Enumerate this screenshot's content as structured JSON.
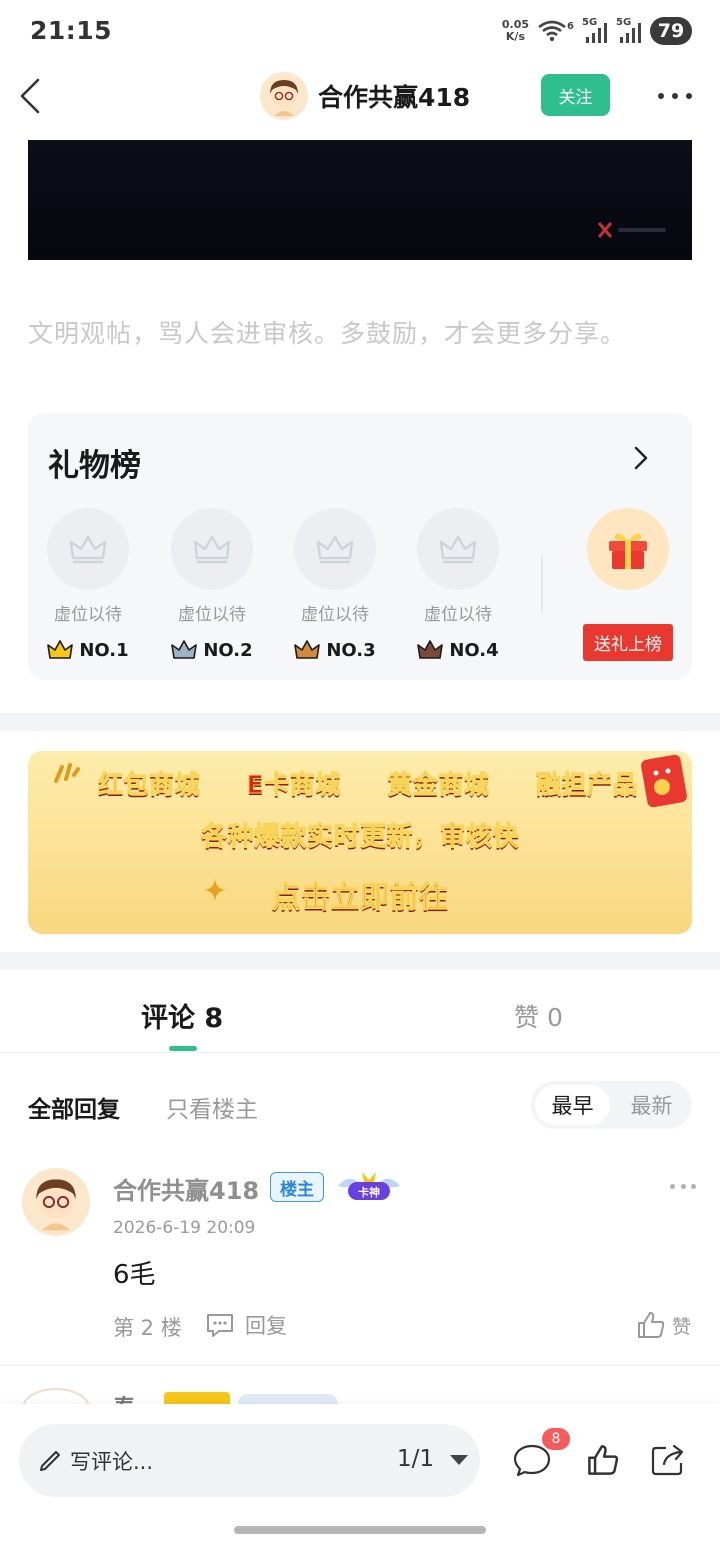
{
  "status_bar": {
    "time": "21:15",
    "net_speed_value": "0.05",
    "net_speed_unit": "K/s",
    "wifi_sub": "6",
    "sig1": "5G",
    "sig2": "5G",
    "battery": "79"
  },
  "header": {
    "title": "合作共赢418",
    "follow_label": "关注"
  },
  "notice": "文明观帖，骂人会进审核。多鼓励，才会更多分享。",
  "gift_board": {
    "title": "礼物榜",
    "slots": [
      {
        "label": "虚位以待",
        "rank": "NO.1",
        "crown_color": "#f5c518"
      },
      {
        "label": "虚位以待",
        "rank": "NO.2",
        "crown_color": "#9fb3c8"
      },
      {
        "label": "虚位以待",
        "rank": "NO.3",
        "crown_color": "#d48a3b"
      },
      {
        "label": "虚位以待",
        "rank": "NO.4",
        "crown_color": "#7a4b3a"
      }
    ],
    "send_label": "送礼上榜"
  },
  "promo": {
    "items": [
      "红包商城",
      "E卡商城",
      "黄金商城",
      "融担产品"
    ],
    "line2": "各种爆款实时更新，审核快",
    "line3": "点击立即前往"
  },
  "tabs": {
    "comments": "评论 8",
    "likes": "赞 0"
  },
  "filters": {
    "all": "全部回复",
    "op_only": "只看楼主",
    "sort_early": "最早",
    "sort_new": "最新"
  },
  "comments": [
    {
      "user": "合作共赢418",
      "badge": "楼主",
      "medal": "卡神",
      "time": "2026-6-19 20:09",
      "text": "6毛",
      "floor": "第 2 楼",
      "reply_label": "回复",
      "like_label": "赞"
    }
  ],
  "next_comment_peek": {
    "user": "泰"
  },
  "bottom_bar": {
    "write_label": "写评论...",
    "page": "1/1",
    "comment_count": "8"
  },
  "colors": {
    "accent": "#2fbf8f",
    "danger": "#e8382f",
    "badge_blue": "#3b9bea"
  }
}
